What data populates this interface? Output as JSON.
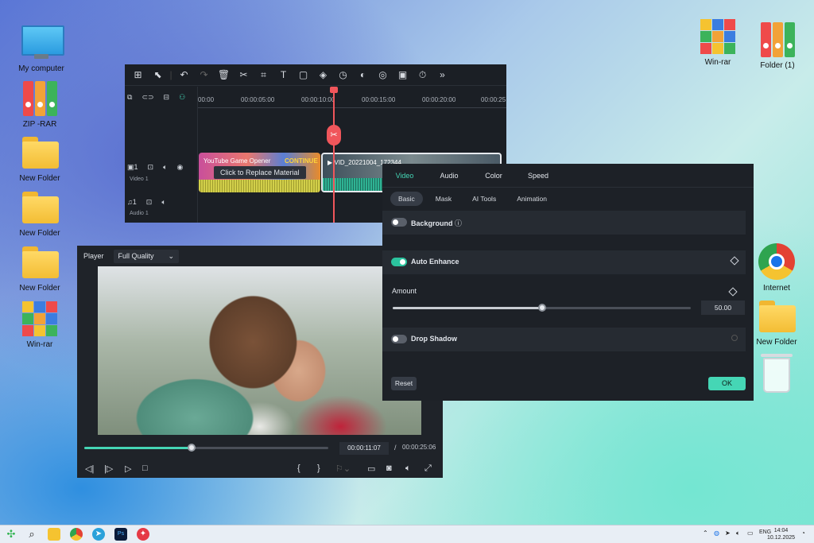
{
  "desktop": {
    "icons_left": [
      {
        "label": "My computer",
        "icon": "monitor-icon"
      },
      {
        "label": "ZIP -RAR",
        "icon": "binders-icon"
      },
      {
        "label": "New Folder",
        "icon": "folder-icon"
      },
      {
        "label": "New Folder",
        "icon": "folder-icon"
      },
      {
        "label": "New Folder",
        "icon": "folder-icon"
      },
      {
        "label": "Win-rar",
        "icon": "winrar-icon"
      }
    ],
    "icons_right": [
      {
        "label": "Win-rar",
        "icon": "winrar-icon"
      },
      {
        "label": "Folder (1)",
        "icon": "binders-icon"
      },
      {
        "label": "Internet",
        "icon": "chrome-icon"
      },
      {
        "label": "New Folder",
        "icon": "folder-icon"
      },
      {
        "label": "",
        "icon": "trash-icon"
      }
    ]
  },
  "timeline": {
    "toolbar_icons": [
      "grid-icon",
      "select-icon",
      "undo-icon",
      "redo-icon",
      "delete-icon",
      "scissors-icon",
      "crop-icon",
      "text-icon",
      "shape-icon",
      "effects-icon",
      "speed-icon",
      "color-icon",
      "ai-icon",
      "mask-icon",
      "timer-icon",
      "more-icon"
    ],
    "ruler": [
      "00:00",
      "00:00:05:00",
      "00:00:10:00",
      "00:00:15:00",
      "00:00:20:00",
      "00:00:25"
    ],
    "video_track_label": "Video 1",
    "audio_track_label": "Audio 1",
    "video_track_num": "1",
    "audio_track_num": "1",
    "clip1_title": "YouTube Game Opener",
    "clip1_badge": "CONTINUE",
    "clip2_title": "VID_20221004_172344",
    "tooltip": "Click to Replace Material"
  },
  "player": {
    "title": "Player",
    "quality": "Full Quality",
    "current_time": "00:00:11:07",
    "separator": "/",
    "total_time": "00:00:25:06",
    "progress": 0.44
  },
  "properties": {
    "tabs": [
      "Video",
      "Audio",
      "Color",
      "Speed"
    ],
    "active_tab": "Video",
    "subtabs": [
      "Basic",
      "Mask",
      "AI Tools",
      "Animation"
    ],
    "active_subtab": "Basic",
    "background_label": "Background",
    "auto_enhance_label": "Auto Enhance",
    "amount_label": "Amount",
    "amount_value": "50.00",
    "amount_fraction": 0.5,
    "drop_shadow_label": "Drop Shadow",
    "reset_label": "Reset",
    "ok_label": "OK"
  },
  "taskbar": {
    "lang": "ENG",
    "time": "14:04",
    "date": "10.12.2025"
  },
  "colors": {
    "accent": "#45d6b5",
    "playhead": "#f0565b"
  }
}
